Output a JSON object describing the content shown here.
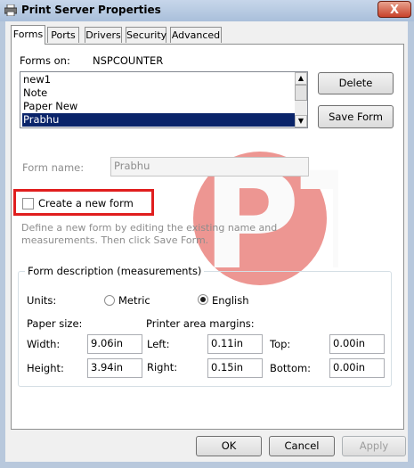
{
  "window": {
    "title": "Print Server Properties",
    "close_label": "X"
  },
  "tabs": [
    {
      "label": "Forms",
      "active": true
    },
    {
      "label": "Ports"
    },
    {
      "label": "Drivers"
    },
    {
      "label": "Security"
    },
    {
      "label": "Advanced"
    }
  ],
  "forms_panel": {
    "forms_on_label": "Forms on:",
    "server_name": "NSPCOUNTER",
    "list_items": [
      "new1",
      "Note",
      "Paper New",
      "Prabhu"
    ],
    "selected_item": "Prabhu",
    "delete_button": "Delete",
    "save_form_button": "Save Form",
    "form_name_label": "Form name:",
    "form_name_value": "Prabhu",
    "create_new_form_label": "Create a new form",
    "create_new_form_checked": false,
    "help_text_line1": "Define a new form by editing the existing name and",
    "help_text_line2": "measurements. Then click Save Form.",
    "description": {
      "title": "Form description (measurements)",
      "units_label": "Units:",
      "metric_label": "Metric",
      "english_label": "English",
      "selected_unit": "English",
      "paper_size_label": "Paper size:",
      "printer_margins_label": "Printer area margins:",
      "width_label": "Width:",
      "width_value": "9.06in",
      "height_label": "Height:",
      "height_value": "3.94in",
      "left_label": "Left:",
      "left_value": "0.11in",
      "right_label": "Right:",
      "right_value": "0.15in",
      "top_label": "Top:",
      "top_value": "0.00in",
      "bottom_label": "Bottom:",
      "bottom_value": "0.00in"
    }
  },
  "footer": {
    "ok_button": "OK",
    "cancel_button": "Cancel",
    "apply_button": "Apply"
  },
  "watermark": {
    "text": "PT",
    "color": "#e0413a"
  },
  "colors": {
    "highlight_box": "#e01e1e",
    "selection": "#0a246a"
  }
}
